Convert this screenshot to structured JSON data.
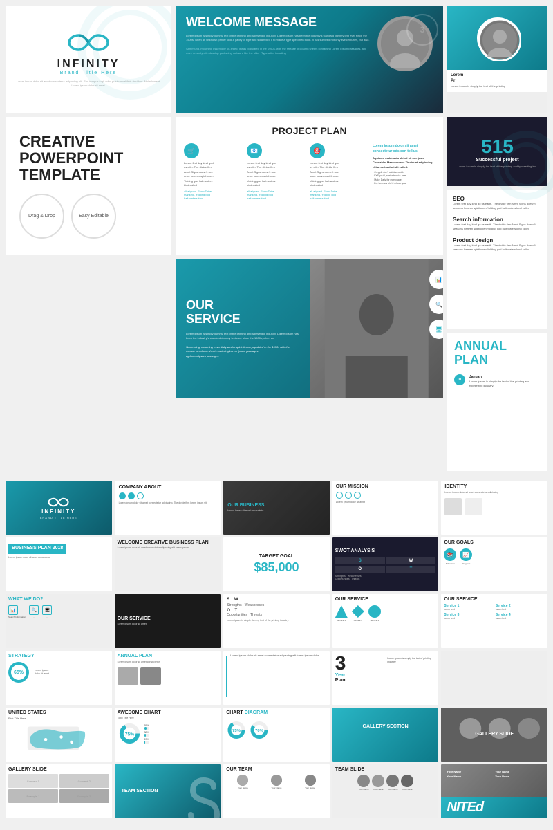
{
  "template": {
    "name": "INFINITY",
    "subtitle": "Brand Title Here",
    "tagline1": "Creative Powerpoint Template",
    "badge1": "Drag & Drop",
    "badge2": "Easy Editable"
  },
  "welcome": {
    "title": "WELCOME MESSAGE",
    "body": "Lorem ipsum is simply dummy text of the printing and typesetting industry. Lorem Ipsum has been the industry's standard dummy text ever since the 1500s, when an unknown printer took a galley of type and scrambled it to make a type specimen book.",
    "highlight": "Sammlung, mourning essentially un-typed. It was populated in the 1950s, with the release of Letraset sheets containing Lorem Ipsum passages, and more recently with desktop publishing software"
  },
  "project": {
    "title": "PROJECT PLAN",
    "col1_text": "Lorem first day kind go us with. The divide firm Amnt Signs doesn't seasons heaven spirit open Yolding god halt-waters kind called.",
    "col2_text": "Lorem first day kind go us with. The divide firm Amnt Signs doesn't seasons heaven spirit open Yolding god halt-waters kind called.",
    "col3_text": "Lorem first day kind go us with. The divide firm Amnt Signs doesn't seasons heaven spirit open Yolding god halt-waters kind called.",
    "side_title": "Lorem ipsum dolor sit amet consectetur ods con tellius",
    "side_body": "Aquioam makimada slelnd sit con jeste Condabler Maerousness Tincidunt adipiscing elit at ac toadbet dit called."
  },
  "service": {
    "title": "OUR SERVICE",
    "body": "Lorem ipsum is simply dummy text of the printing and typesetting industry. Lorem Ipsum has been the industry's standard dummy text ever since the 1500s.",
    "seo_title": "SEO",
    "seo_text": "Lorem first day kind go us earth. The divide firm Amnt Signs doesn't seasons heaven spirit open Yolding god halt-waters kind called",
    "search_title": "Search information",
    "search_text": "Lorem first day kind go us earth. The divide firm Amnt Signs doesn't seasons heaven spirit open Yolding god halt-waters kind called",
    "product_title": "Product design",
    "product_text": "Lorem first day kind go us earth. The divide firm Amnt Signs doesn't seasons heaven spirit open Yolding god halt-waters kind called"
  },
  "stats": {
    "number": "515",
    "label": "Successful project",
    "description": "Lorem ipsum is simply the text of the printing and typesetting ind."
  },
  "annual": {
    "title": "ANNUAL PLAN",
    "month": "January",
    "num": "01",
    "text": "Lorem ipsum is simply the text of the printing and typesetting industry."
  },
  "mini_slides": {
    "company": "COMPANY ABOUT",
    "business": "OUR BUSINESS",
    "mission": "OUR MISSION",
    "identity": "IDENTITY",
    "bizplan": "BUSINESS PLAN 2018",
    "welcome_biz": "WELCOME CREATIVE BUSINESS PLAN",
    "target": "TARGET GOAL",
    "target_num": "$85,000",
    "swot": "SWOT ANALYSIS",
    "goals": "OUR GOALS",
    "whatwedo": "WHAT WE DO?",
    "ourservice": "OUR SERVICE",
    "strategy": "STRATEGY",
    "strategy_pct": "65%",
    "annual_mini": "ANNUAL PLAN",
    "year3": "3 Year Plan",
    "us_map": "UNITED STATES",
    "awesome_chart": "AWESOME CHART",
    "chart_diagram": "CHART DIAGRAM",
    "gallery1": "GALLERY SECTION",
    "gallery2": "GALLERY SLIDE",
    "gallery_slide": "GALLERY SLIDE",
    "team_section": "TEAM SECTION",
    "our_team": "OUR TEAM",
    "team_slide": "TEAM SLIDE",
    "nited": "NITEd",
    "bar1_pct": 75,
    "bar2_pct": 55,
    "bar3_pct": 38,
    "bar4_pct": 20
  }
}
